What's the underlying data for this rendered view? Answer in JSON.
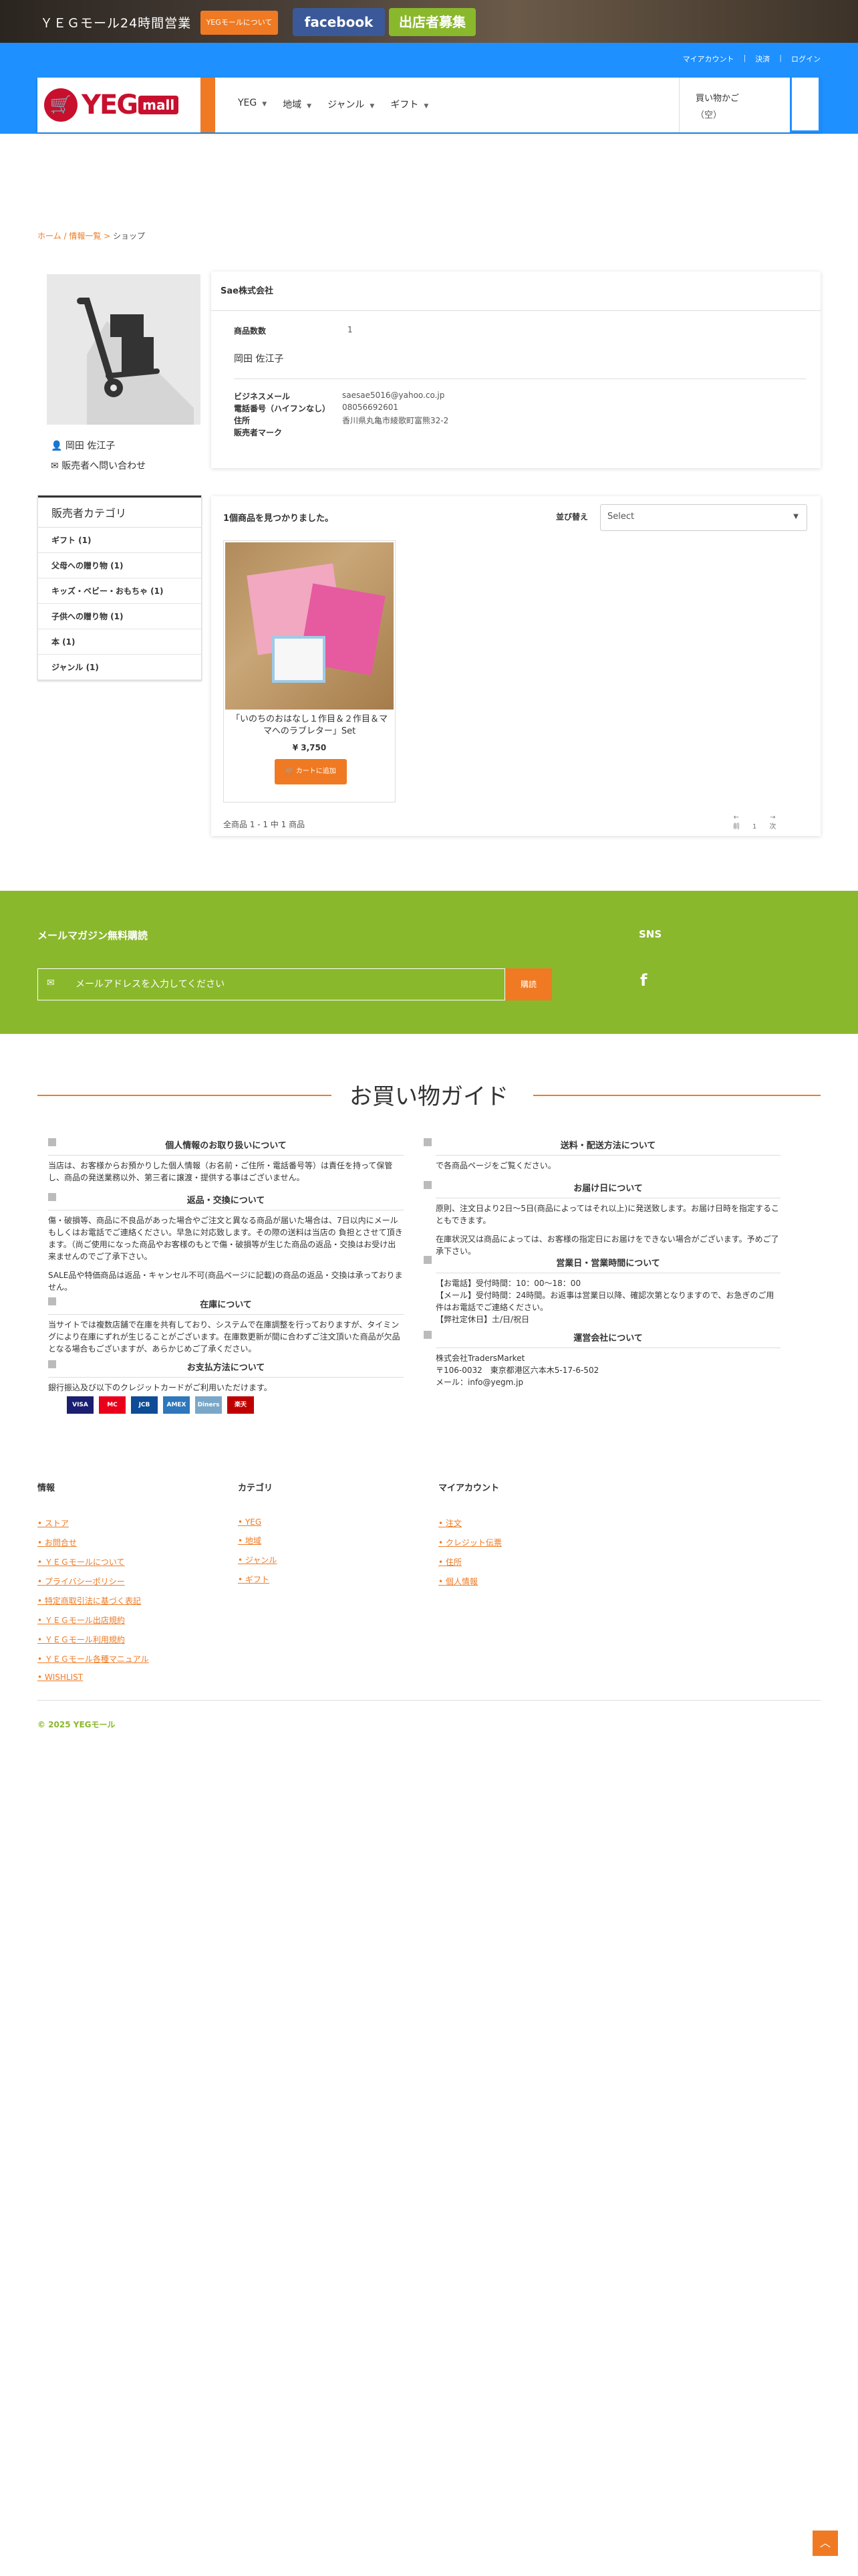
{
  "banner": {
    "hours": "ＹＥＧモール24時間営業",
    "about": "YEGモールについて",
    "facebook": "facebook",
    "shop_recruit": "出店者募集"
  },
  "header": {
    "links": [
      "マイアカウント",
      "決済",
      "ログイン"
    ],
    "logo_yeg": "YEG",
    "logo_mall": "mall",
    "nav": [
      "YEG",
      "地域",
      "ジャンル",
      "ギフト"
    ],
    "cart_label": "買い物かご",
    "cart_count": "（空）"
  },
  "breadcrumb": {
    "home": "ホーム",
    "list": "情報一覧",
    "current": "ショップ"
  },
  "seller": {
    "name": "岡田 佐江子",
    "contact": "販売者へ問い合わせ",
    "category_title": "販売者カテゴリ",
    "categories": [
      "ギフト (1)",
      "父母への贈り物 (1)",
      "キッズ・ベビー・おもちゃ (1)",
      "子供への贈り物 (1)",
      "本 (1)",
      "ジャンル (1)"
    ]
  },
  "info": {
    "company": "Sae株式会社",
    "count_label": "商品数数",
    "count_value": "1",
    "owner": "岡田 佐江子",
    "rows": [
      {
        "label": "ビジネスメール",
        "value": "saesae5016@yahoo.co.jp"
      },
      {
        "label": "電話番号（ハイフンなし）",
        "value": "08056692601"
      },
      {
        "label": "住所",
        "value": "香川県丸亀市綾歌町富熊32-2"
      },
      {
        "label": "販売者マーク",
        "value": ""
      }
    ]
  },
  "products": {
    "found": "1個商品を見つかりました。",
    "sort_label": "並び替え",
    "sort_value": "Select",
    "items": [
      {
        "name": "「いのちのおはなし１作目＆２作目＆ママへのラブレター」Set",
        "price": "¥ 3,750",
        "button": "カートに追加"
      }
    ],
    "summary": "全商品 1 - 1 中 1 商品",
    "pager_prev": "前",
    "pager_page": "1",
    "pager_next": "次"
  },
  "newsletter": {
    "title": "メールマガジン無料購読",
    "placeholder": "メールアドレスを入力してください",
    "button": "購読",
    "sns": "SNS"
  },
  "guide": {
    "title": "お買い物ガイド",
    "left": [
      {
        "heading": "個人情報のお取り扱いについて",
        "body": [
          "当店は、お客様からお預かりした個人情報（お名前・ご住所・電話番号等）は責任を持って保管し、商品の発送業務以外、第三者に譲渡・提供する事はございません。"
        ]
      },
      {
        "heading": "返品・交換について",
        "body": [
          "傷・破損等、商品に不良品があった場合やご注文と異なる商品が届いた場合は、7日以内にメールもしくはお電話でご連絡ください。早急に対応致します。その際の送料は当店の 負担とさせて頂きます。（尚ご使用になった商品やお客様のもとで傷・破損等が生じた商品の返品・交換はお受け出来ませんのでご了承下さい。",
          "SALE品や特価商品は返品・キャンセル不可(商品ページに記載)の商品の返品・交換は承っておりません。"
        ]
      },
      {
        "heading": "在庫について",
        "body": [
          "当サイトでは複数店舗で在庫を共有しており、システムで在庫調整を行っておりますが、タイミングにより在庫にずれが生じることがございます。在庫数更新が間に合わずご注文頂いた商品が欠品となる場合もございますが、あらかじめご了承ください。"
        ]
      },
      {
        "heading": "お支払方法について",
        "body": [
          "銀行振込及び以下のクレジットカードがご利用いただけます。"
        ]
      }
    ],
    "right": [
      {
        "heading": "送料・配送方法について",
        "body": [
          "で各商品ページをご覧ください。"
        ]
      },
      {
        "heading": "お届け日について",
        "body": [
          "原則、注文日より2日〜5日(商品によってはそれ以上)に発送致します。お届け日時を指定することもできます。",
          "在庫状況又は商品によっては、お客様の指定日にお届けをできない場合がございます。予めご了承下さい。"
        ]
      },
      {
        "heading": "営業日・営業時間について",
        "body": [
          "【お電話】受付時間：10：00〜18：00",
          "【メール】受付時間：24時間。お返事は営業日以降、確認次第となりますので、お急ぎのご用件はお電話でご連絡ください。",
          "【弊社定休日】土/日/祝日"
        ]
      },
      {
        "heading": "運営会社について",
        "body": [
          "株式会社TradersMarket",
          "〒106-0032　東京都港区六本木5-17-6-502",
          "メール：info@yegm.jp"
        ]
      }
    ],
    "cards": [
      "VISA",
      "MC",
      "JCB",
      "AMEX",
      "Diners",
      "楽天"
    ]
  },
  "footer": {
    "col1_title": "情報",
    "col1": [
      "ストア",
      "お問合せ",
      "ＹＥＧモールについて",
      "プライバシーポリシー",
      "特定商取引法に基づく表記",
      "ＹＥＧモール出店規約",
      "ＹＥＧモール利用規約",
      "ＹＥＧモール各種マニュアル",
      "WISHLIST"
    ],
    "col2_title": "カテゴリ",
    "col2": [
      "YEG",
      "地域",
      "ジャンル",
      "ギフト"
    ],
    "col3_title": "マイアカウント",
    "col3": [
      "注文",
      "クレジット伝票",
      "住所",
      "個人情報"
    ],
    "copyright": "© 2025 YEGモール"
  },
  "colors": {
    "accent": "#ef7a23",
    "header": "#1e90ff",
    "green": "#8ab82c",
    "brand_red": "#c8102e"
  }
}
